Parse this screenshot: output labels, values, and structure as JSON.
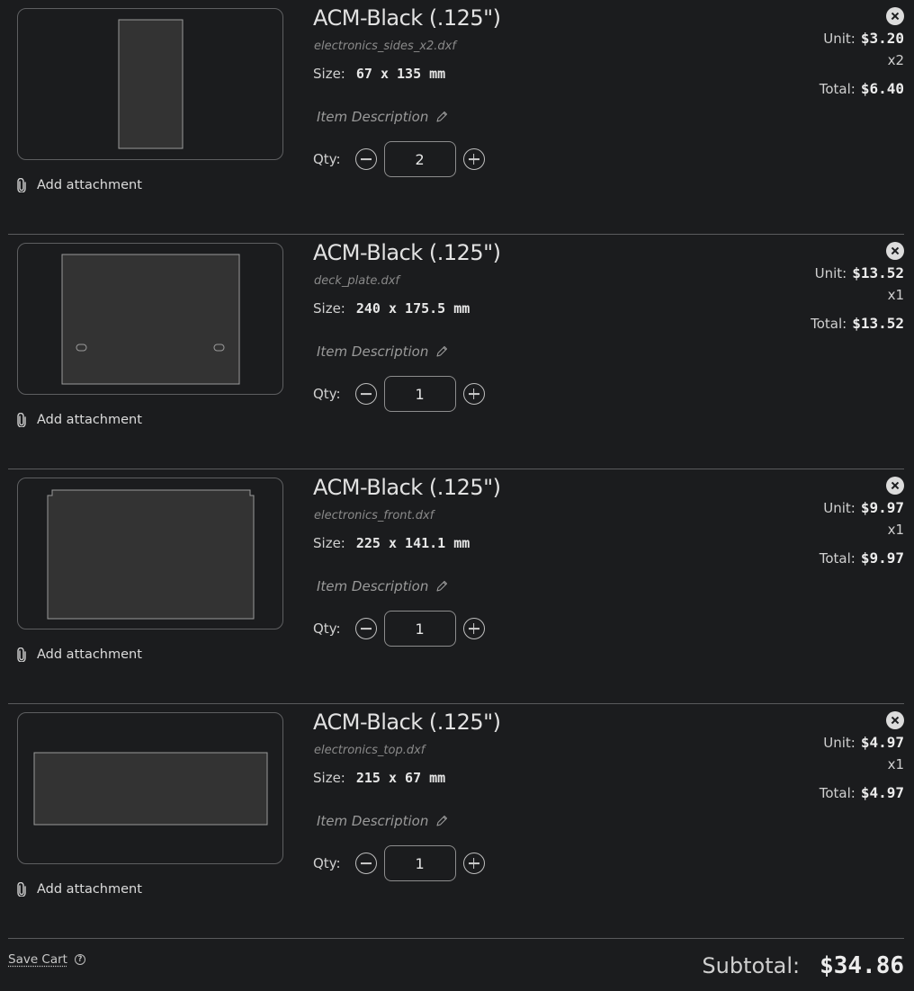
{
  "items": [
    {
      "title": "ACM-Black (.125\")",
      "filename": "electronics_sides_x2.dxf",
      "size_label": "Size:",
      "size": "67 x 135 mm",
      "description_placeholder": "Item Description",
      "qty_label": "Qty:",
      "qty": "2",
      "unit_label": "Unit:",
      "unit_price": "$3.20",
      "multiplier": "x2",
      "total_label": "Total:",
      "total": "$6.40",
      "attach_label": "Add attachment"
    },
    {
      "title": "ACM-Black (.125\")",
      "filename": "deck_plate.dxf",
      "size_label": "Size:",
      "size": "240 x 175.5 mm",
      "description_placeholder": "Item Description",
      "qty_label": "Qty:",
      "qty": "1",
      "unit_label": "Unit:",
      "unit_price": "$13.52",
      "multiplier": "x1",
      "total_label": "Total:",
      "total": "$13.52",
      "attach_label": "Add attachment"
    },
    {
      "title": "ACM-Black (.125\")",
      "filename": "electronics_front.dxf",
      "size_label": "Size:",
      "size": "225 x 141.1 mm",
      "description_placeholder": "Item Description",
      "qty_label": "Qty:",
      "qty": "1",
      "unit_label": "Unit:",
      "unit_price": "$9.97",
      "multiplier": "x1",
      "total_label": "Total:",
      "total": "$9.97",
      "attach_label": "Add attachment"
    },
    {
      "title": "ACM-Black (.125\")",
      "filename": "electronics_top.dxf",
      "size_label": "Size:",
      "size": "215 x 67 mm",
      "description_placeholder": "Item Description",
      "qty_label": "Qty:",
      "qty": "1",
      "unit_label": "Unit:",
      "unit_price": "$4.97",
      "multiplier": "x1",
      "total_label": "Total:",
      "total": "$4.97",
      "attach_label": "Add attachment"
    }
  ],
  "footer": {
    "save_label": "Save Cart",
    "help_glyph": "?",
    "subtotal_label": "Subtotal:",
    "subtotal": "$34.86"
  },
  "colors": {
    "background": "#1b1c1e",
    "part_fill": "#333333",
    "part_stroke": "#9a9a9a"
  }
}
